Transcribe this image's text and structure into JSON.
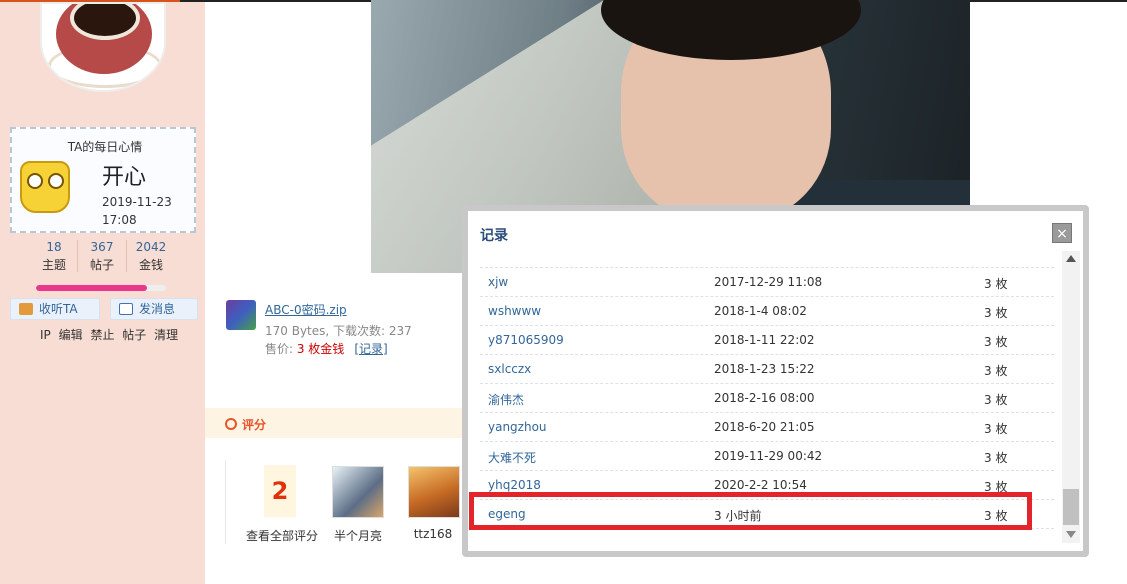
{
  "profile": {
    "mood_title": "TA的每日心情",
    "mood_text": "开心",
    "mood_date": "2019-11-23",
    "mood_time": "17:08",
    "stats": [
      {
        "num": "18",
        "label": "主题"
      },
      {
        "num": "367",
        "label": "帖子"
      },
      {
        "num": "2042",
        "label": "金钱"
      }
    ],
    "level_progress": 0.85,
    "listen_label": "收听TA",
    "message_label": "发消息",
    "admin_links": [
      "IP",
      "编辑",
      "禁止",
      "帖子",
      "清理"
    ]
  },
  "attachment": {
    "name": "ABC-0密码.zip",
    "meta": "170 Bytes, 下载次数: 237",
    "price_prefix": "售价: ",
    "price_value": "3 枚金钱",
    "record_link": "[记录]"
  },
  "rating": {
    "title": "评分",
    "count": "2",
    "view_all_label": "查看全部评分",
    "raters": [
      "半个月亮",
      "ttz168"
    ]
  },
  "modal": {
    "title": "记录",
    "close_label": "×",
    "rows": [
      {
        "user": "xjw",
        "time": "2017-12-29 11:08",
        "amount": "3 枚"
      },
      {
        "user": "wshwww",
        "time": "2018-1-4 08:02",
        "amount": "3 枚"
      },
      {
        "user": "y871065909",
        "time": "2018-1-11 22:02",
        "amount": "3 枚"
      },
      {
        "user": "sxlcczx",
        "time": "2018-1-23 15:22",
        "amount": "3 枚"
      },
      {
        "user": "渝伟杰",
        "time": "2018-2-16 08:00",
        "amount": "3 枚"
      },
      {
        "user": "yangzhou",
        "time": "2018-6-20 21:05",
        "amount": "3 枚"
      },
      {
        "user": "大难不死",
        "time": "2019-11-29 00:42",
        "amount": "3 枚"
      },
      {
        "user": "yhq2018",
        "time": "2020-2-2 10:54",
        "amount": "3 枚"
      },
      {
        "user": "egeng",
        "time": "3 小时前",
        "amount": "3 枚"
      }
    ]
  },
  "colors": {
    "sidebar_bg": "#f7ddd3",
    "link": "#336699",
    "accent_red": "#e3242b",
    "rating_orange": "#e8542a"
  }
}
